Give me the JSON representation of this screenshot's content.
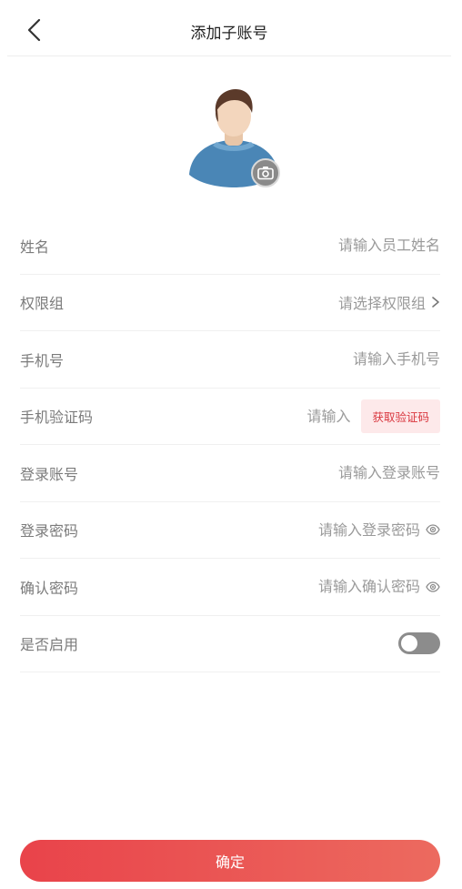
{
  "header": {
    "title": "添加子账号"
  },
  "avatar": {
    "icon": "user-avatar-icon",
    "camera_icon": "camera-icon"
  },
  "form": {
    "name": {
      "label": "姓名",
      "placeholder": "请输入员工姓名"
    },
    "permission_group": {
      "label": "权限组",
      "placeholder": "请选择权限组"
    },
    "phone": {
      "label": "手机号",
      "placeholder": "请输入手机号"
    },
    "sms_code": {
      "label": "手机验证码",
      "placeholder": "请输入",
      "button": "获取验证码"
    },
    "login_account": {
      "label": "登录账号",
      "placeholder": "请输入登录账号"
    },
    "login_password": {
      "label": "登录密码",
      "placeholder": "请输入登录密码"
    },
    "confirm_password": {
      "label": "确认密码",
      "placeholder": "请输入确认密码"
    },
    "enabled": {
      "label": "是否启用",
      "value": false
    }
  },
  "confirm_button": "确定",
  "colors": {
    "accent": "#e9434a",
    "code_bg": "#fde9ea",
    "toggle_off": "#8c8c8c"
  }
}
